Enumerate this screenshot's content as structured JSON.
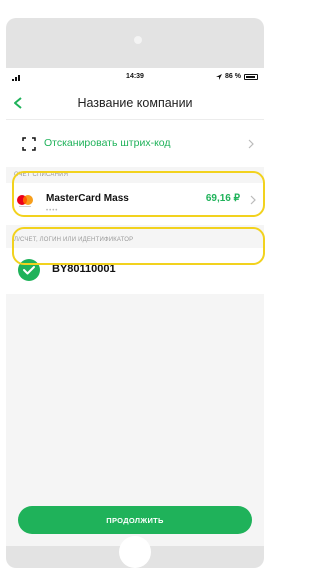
{
  "status_bar": {
    "time": "14:39",
    "battery": "86 %"
  },
  "header": {
    "title": "Название компании"
  },
  "scan": {
    "label": "Отсканировать штрих-код"
  },
  "debit_section": {
    "label": "СЧЕТ СПИСАНИЯ",
    "card_name": "MasterCard Mass",
    "card_mask": "••••",
    "amount": "69,16 ₽"
  },
  "account_section": {
    "label": "Л/СЧЕТ, ЛОГИН ИЛИ ИДЕНТИФИКАТОР",
    "value": "BY80110001"
  },
  "footer": {
    "continue_label": "ПРОДОЛЖИТЬ"
  },
  "colors": {
    "accent": "#1fb25a",
    "highlight": "#f2d21e",
    "frame": "#e3e3e3"
  }
}
